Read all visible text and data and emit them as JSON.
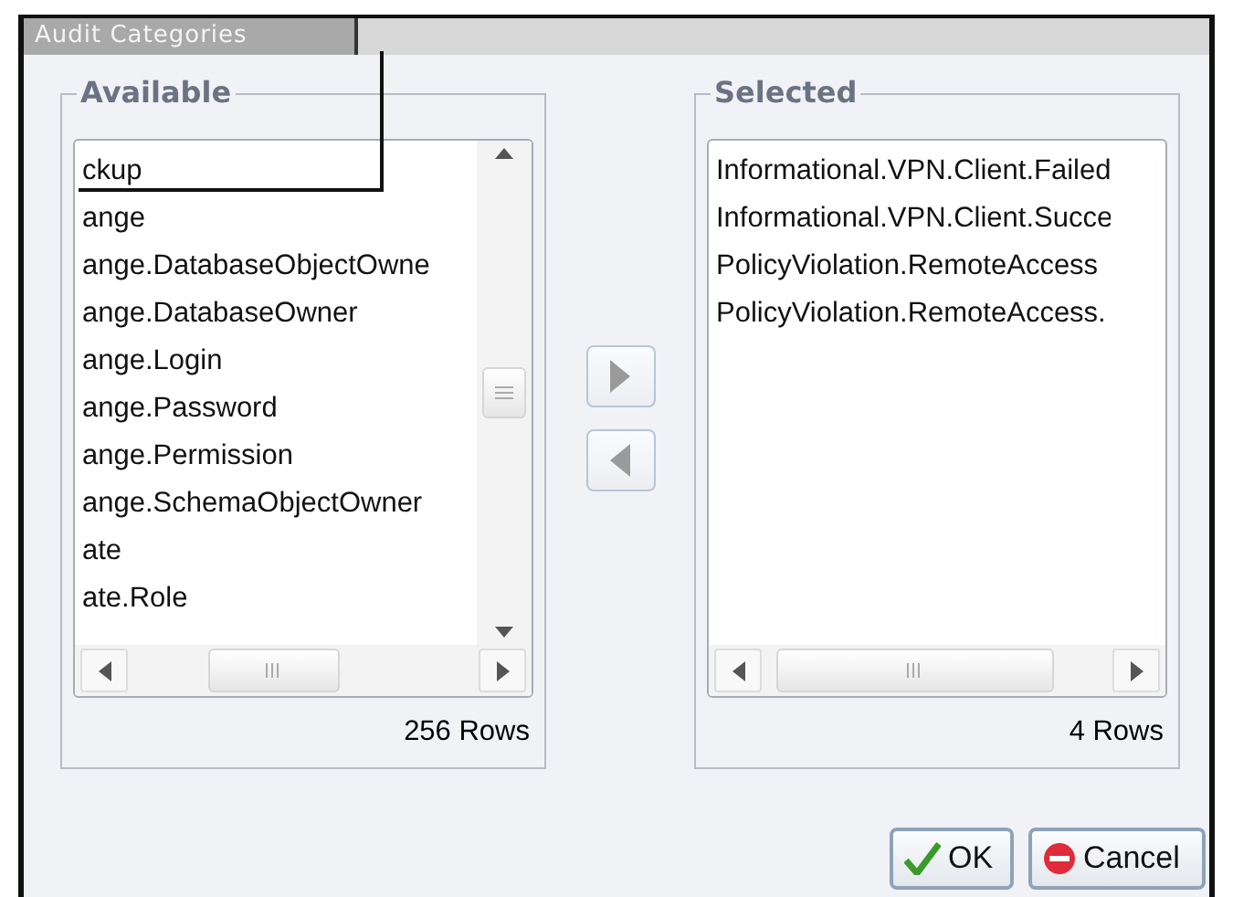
{
  "window": {
    "title": "Audit Categories"
  },
  "available": {
    "legend": "Available",
    "items": [
      {
        "label": "ckup",
        "selected": false
      },
      {
        "label": "ange",
        "selected": false
      },
      {
        "label": "ange.DatabaseObjectOwne",
        "selected": false
      },
      {
        "label": "ange.DatabaseOwner",
        "selected": false
      },
      {
        "label": "ange.Login",
        "selected": false
      },
      {
        "label": "ange.Password",
        "selected": false
      },
      {
        "label": "ange.Permission",
        "selected": false
      },
      {
        "label": "ange.SchemaObjectOwner",
        "selected": false
      },
      {
        "label": "ate",
        "selected": false
      },
      {
        "label": "ate.Role",
        "selected": false
      }
    ],
    "row_count": "256 Rows"
  },
  "move_buttons": [
    {
      "kind": "add"
    },
    {
      "kind": "remove"
    }
  ],
  "selected": {
    "legend": "Selected",
    "items": [
      {
        "label": "Informational.VPN.Client.Failed",
        "selected": false
      },
      {
        "label": "Informational.VPN.Client.Succe",
        "selected": false
      },
      {
        "label": "PolicyViolation.RemoteAccess",
        "selected": false
      },
      {
        "label": "PolicyViolation.RemoteAccess.",
        "selected": false
      }
    ],
    "row_count": "4 Rows"
  },
  "buttons": [
    {
      "kind": "ok",
      "label": "OK"
    },
    {
      "kind": "cancel",
      "label": "Cancel"
    }
  ]
}
